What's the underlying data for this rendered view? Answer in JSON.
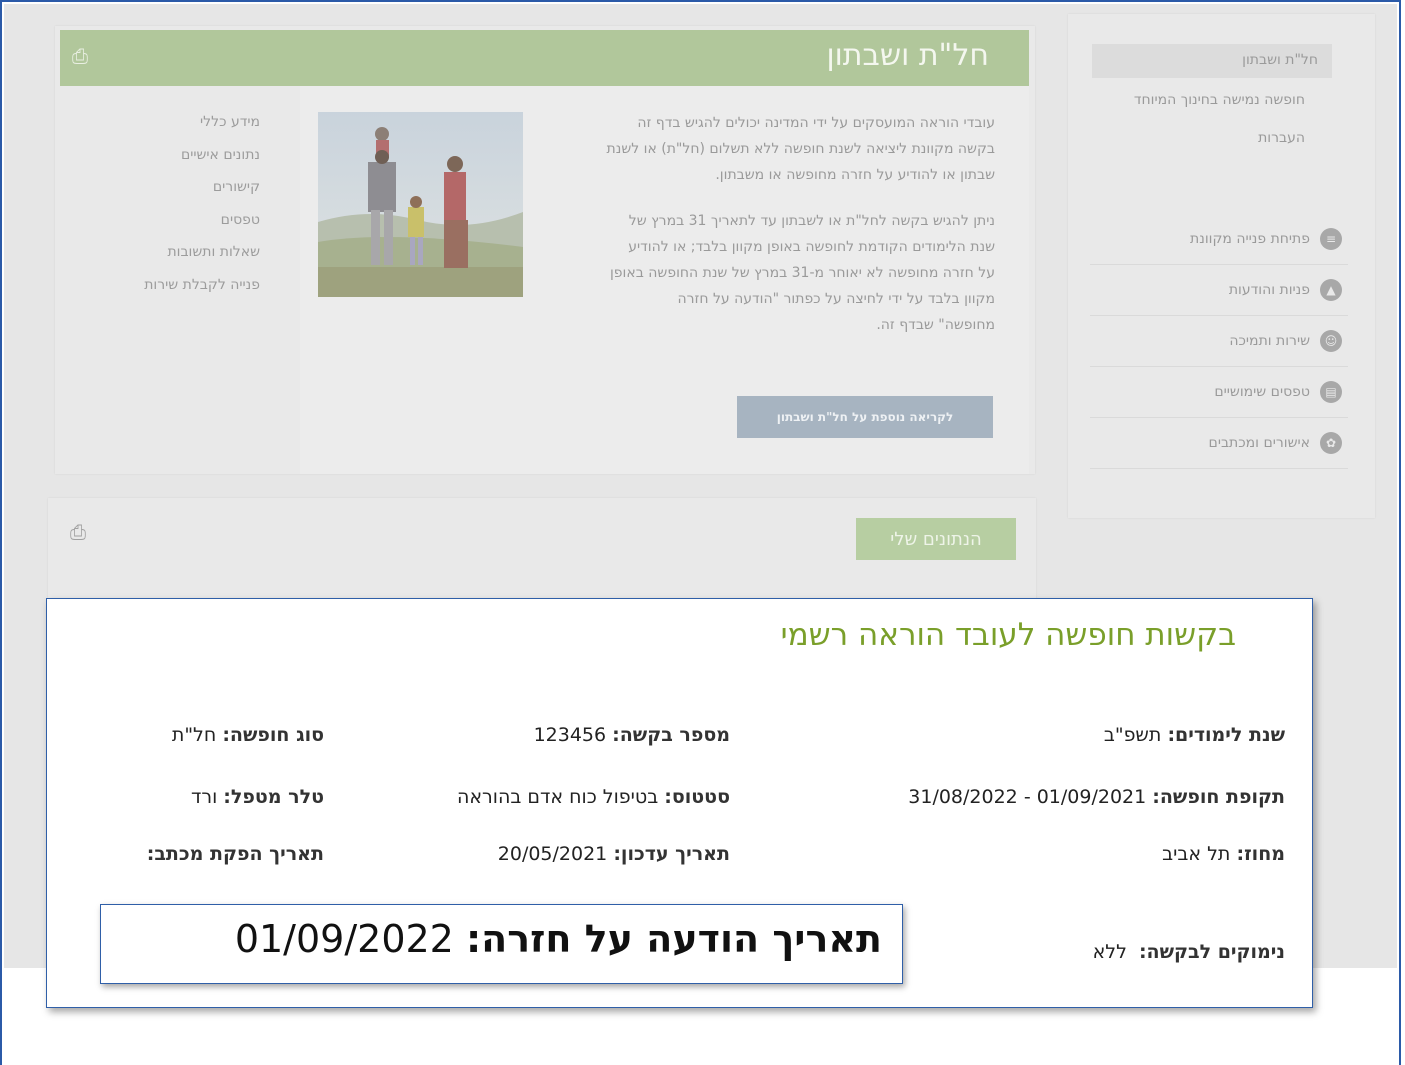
{
  "sidebar": {
    "active_item": "חל\"ת ושבתון",
    "links": [
      "חופשה נמישה בחינוך המיוחד",
      "העברות"
    ],
    "nav": [
      {
        "label": "פתיחת פנייה מקוונת",
        "icon": "chat-icon"
      },
      {
        "label": "פניות והודעות",
        "icon": "inbox-icon"
      },
      {
        "label": "שירות ותמיכה",
        "icon": "support-icon"
      },
      {
        "label": "טפסים שימושיים",
        "icon": "forms-icon"
      },
      {
        "label": "אישורים ומכתבים",
        "icon": "certificate-icon"
      }
    ]
  },
  "main": {
    "title": "חל\"ת ושבתון",
    "menu": [
      "מידע כללי",
      "נתונים אישיים",
      "קישורים",
      "טפסים",
      "שאלות ותשובות",
      "פנייה לקבלת שירות"
    ],
    "paragraph1": [
      "עובדי הוראה המועסקים על ידי המדינה יכולים להגיש בדף זה",
      "בקשה מקוונת ליציאה לשנת חופשה ללא תשלום (חל\"ת) או לשנת",
      "שבתון או להודיע על חזרה מחופשה או משבתון."
    ],
    "paragraph2": [
      "ניתן להגיש בקשה לחל\"ת או לשבתון עד לתאריך 31 במרץ של",
      "שנת הלימודים הקודמת לחופשה באופן מקוון בלבד; או להודיע",
      "על חזרה מחופשה לא יאוחר מ-31 במרץ של שנת החופשה באופן",
      "מקוון בלבד על ידי לחיצה על כפתור \"הודעה על חזרה",
      "מחופשה\" שבדף זה."
    ],
    "more_button": "לקריאה נוספת על חל\"ת ושבתון"
  },
  "my_data": {
    "button": "הנתונים שלי"
  },
  "popup": {
    "title": "בקשות חופשה לעובד הוראה רשמי",
    "school_year_label": "שנת לימודים:",
    "school_year_value": "תשפ\"ב",
    "request_number_label": "מספר בקשה:",
    "request_number_value": "123456",
    "leave_type_label": "סוג חופשה:",
    "leave_type_value": "חל\"ת",
    "leave_period_label": "תקופת חופשה:",
    "leave_period_value": "31/08/2022 - 01/09/2021",
    "status_label": "סטטוס:",
    "status_value": "בטיפול כוח אדם בהוראה",
    "handler_label": "טלר מטפל:",
    "handler_value": "ורד",
    "district_label": "מחוז:",
    "district_value": "תל אביב",
    "update_date_label": "תאריך עדכון:",
    "update_date_value": "20/05/2021",
    "letter_date_label": "תאריך הפקת מכתב:",
    "reasons_label": "נימוקים לבקשה:",
    "reasons_value": "ללא",
    "return_label": "תאריך הודעה על חזרה:",
    "return_value": "01/09/2022"
  },
  "colors": {
    "header_green": "#b1c79b",
    "title_green": "#7a9f2a",
    "frame_blue": "#2b5aa8"
  }
}
